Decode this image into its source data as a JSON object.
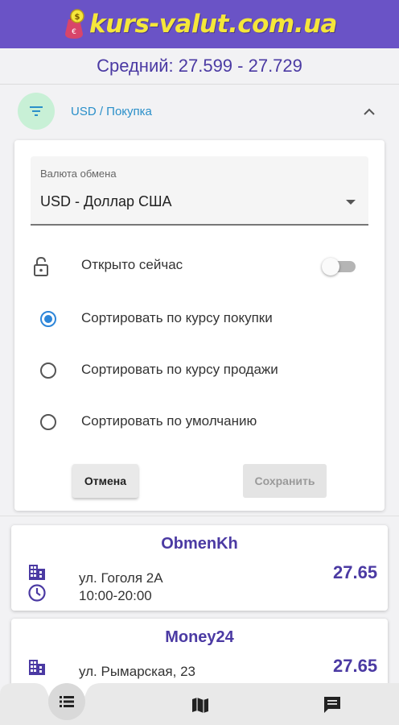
{
  "header": {
    "logo_text": "kurs-valut.com.ua",
    "logo_icon": "money-bag-icon",
    "bg_color": "#6a53c6",
    "logo_color": "#f5e63a"
  },
  "average": {
    "text": "Средний: 27.599 - 27.729"
  },
  "filter": {
    "summary": "USD / Покупка",
    "icon": "filter-icon",
    "expand_icon": "chevron-up-icon"
  },
  "panel": {
    "currency_label": "Валюта обмена",
    "currency_value": "USD - Доллар США",
    "open_now_label": "Открыто сейчас",
    "open_now_on": false,
    "sort_options": [
      {
        "label": "Сортировать по курсу покупки",
        "selected": true
      },
      {
        "label": "Сортировать по курсу продажи",
        "selected": false
      },
      {
        "label": "Сортировать по умолчанию",
        "selected": false
      }
    ],
    "cancel_label": "Отмена",
    "save_label": "Сохранить"
  },
  "cards": [
    {
      "name": "ObmenKh",
      "address": "ул. Гоголя 2А",
      "hours": "10:00-20:00",
      "rate": "27.65"
    },
    {
      "name": "Money24",
      "address": "ул. Рымарская, 23",
      "hours": "",
      "rate": "27.65"
    }
  ],
  "bottom_nav": {
    "items": [
      "list-icon",
      "map-icon",
      "chat-icon"
    ]
  }
}
